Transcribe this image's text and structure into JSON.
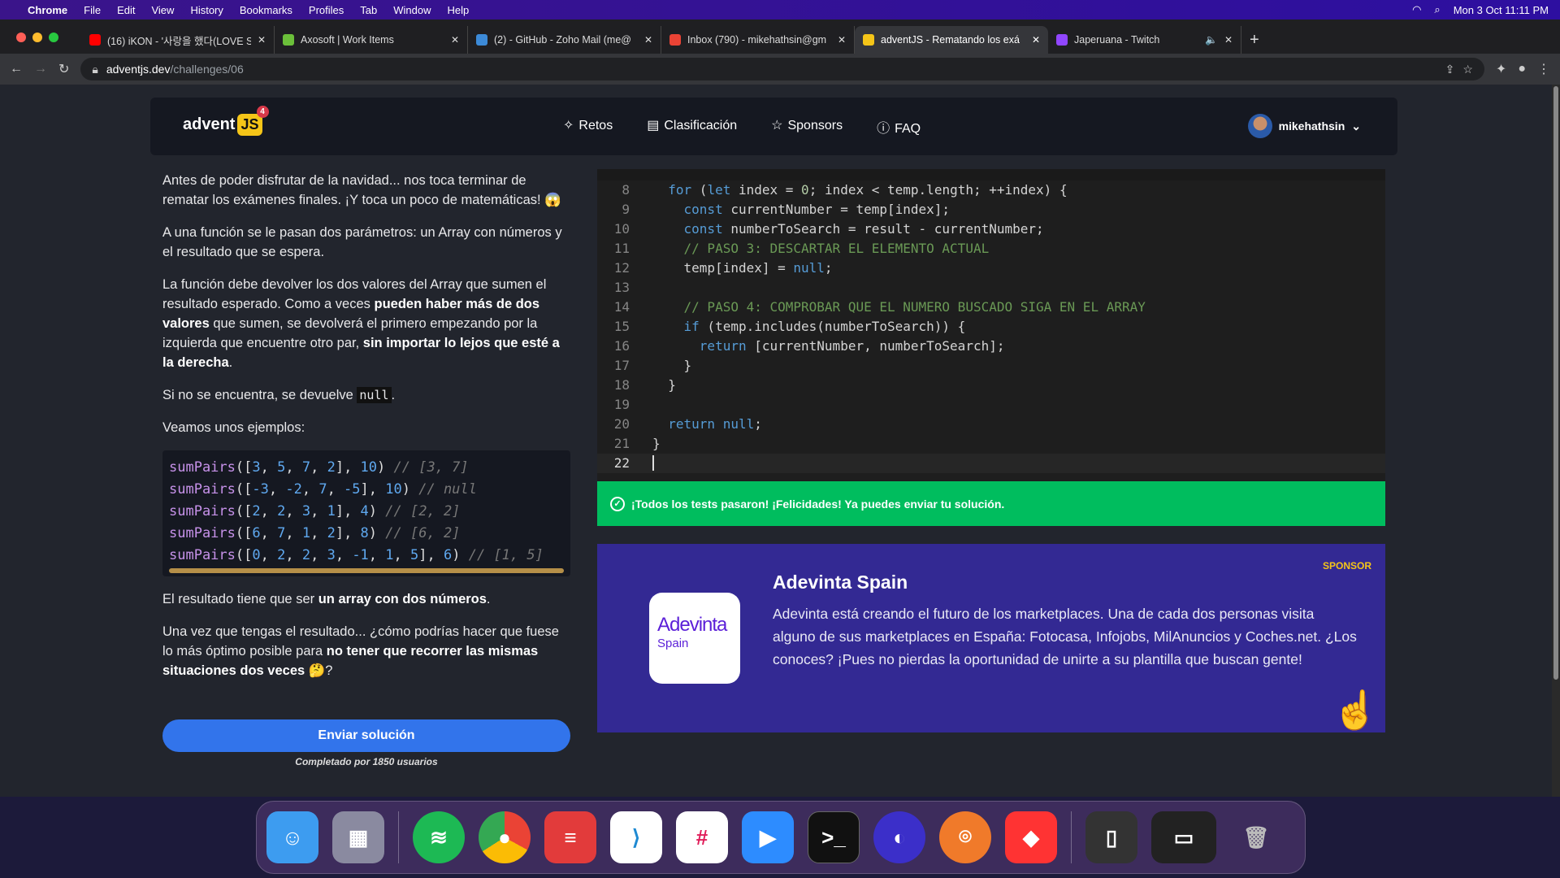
{
  "menubar": {
    "app": "Chrome",
    "items": [
      "File",
      "Edit",
      "View",
      "History",
      "Bookmarks",
      "Profiles",
      "Tab",
      "Window",
      "Help"
    ],
    "clock": "Mon 3 Oct  11:11 PM"
  },
  "tabs": [
    {
      "title": "(16) iKON - '사랑을 했다(LOVE S",
      "color": "#ff0000"
    },
    {
      "title": "Axosoft | Work Items",
      "color": "#6bbf3a"
    },
    {
      "title": "(2) - GitHub - Zoho Mail (me@",
      "color": "#3c8ad8"
    },
    {
      "title": "Inbox (790) - mikehathsin@gm",
      "color": "#ea4335"
    },
    {
      "title": "adventJS - Rematando los exá",
      "color": "#f5c518"
    },
    {
      "title": "Japeruana - Twitch",
      "color": "#9146ff"
    }
  ],
  "address": {
    "host": "adventjs.dev",
    "path": "/challenges/06"
  },
  "header": {
    "logo_text": "advent",
    "logo_js": "JS",
    "logo_badge": "4",
    "nav": [
      "Retos",
      "Clasificación",
      "Sponsors",
      "FAQ"
    ],
    "user": "mikehathsin"
  },
  "description": {
    "p1": "Antes de poder disfrutar de la navidad... nos toca terminar de rematar los exámenes finales. ¡Y toca un poco de matemáticas! 😱",
    "p2": "A una función se le pasan dos parámetros: un Array con números y el resultado que se espera.",
    "p3a": "La función debe devolver los dos valores del Array que sumen el resultado esperado. Como a veces ",
    "p3b": "pueden haber más de dos valores",
    "p3c": " que sumen, se devolverá el primero empezando por la izquierda que encuentre otro par, ",
    "p3d": "sin importar lo lejos que esté a la derecha",
    "p3e": ".",
    "p4a": "Si no se encuentra, se devuelve ",
    "p4code": "null",
    "p4b": ".",
    "p5": "Veamos unos ejemplos:",
    "examples": [
      {
        "fn": "sumPairs",
        "args": "[3, 5, 7, 2], 10",
        "comment": "// [3, 7]"
      },
      {
        "fn": "sumPairs",
        "args": "[-3, -2, 7, -5], 10",
        "comment": "// null"
      },
      {
        "fn": "sumPairs",
        "args": "[2, 2, 3, 1], 4",
        "comment": "// [2, 2]"
      },
      {
        "fn": "sumPairs",
        "args": "[6, 7, 1, 2], 8",
        "comment": "// [6, 2]"
      },
      {
        "fn": "sumPairs",
        "args": "[0, 2, 2, 3, -1, 1, 5], 6",
        "comment": "// [1, 5]"
      }
    ],
    "p6a": "El resultado tiene que ser ",
    "p6b": "un array con dos números",
    "p6c": ".",
    "p7a": "Una vez que tengas el resultado... ¿cómo podrías hacer que fuese lo más óptimo posible para ",
    "p7b": "no tener que recorrer las mismas situaciones dos veces",
    "p7c": " 🤔?"
  },
  "send_button": "Enviar solución",
  "completed": "Completado por 1850 usuarios",
  "editor": {
    "lines": [
      {
        "n": "8",
        "html": "  <span class='kw'>for</span> (<span class='kw'>let</span> index = <span class='nm'>0</span>; index &lt; temp.length; ++index) {"
      },
      {
        "n": "9",
        "html": "    <span class='kw'>const</span> currentNumber = temp[index];"
      },
      {
        "n": "10",
        "html": "    <span class='kw'>const</span> numberToSearch = result - currentNumber;"
      },
      {
        "n": "11",
        "html": "    <span class='cmt'>// PASO 3: DESCARTAR EL ELEMENTO ACTUAL</span>"
      },
      {
        "n": "12",
        "html": "    temp[index] = <span class='kw'>null</span>;"
      },
      {
        "n": "13",
        "html": ""
      },
      {
        "n": "14",
        "html": "    <span class='cmt'>// PASO 4: COMPROBAR QUE EL NUMERO BUSCADO SIGA EN EL ARRAY</span>"
      },
      {
        "n": "15",
        "html": "    <span class='kw'>if</span> (temp.includes(numberToSearch)) {"
      },
      {
        "n": "16",
        "html": "      <span class='kw'>return</span> [currentNumber, numberToSearch];"
      },
      {
        "n": "17",
        "html": "    }"
      },
      {
        "n": "18",
        "html": "  }"
      },
      {
        "n": "19",
        "html": ""
      },
      {
        "n": "20",
        "html": "  <span class='kw'>return</span> <span class='kw'>null</span>;"
      },
      {
        "n": "21",
        "html": "}"
      },
      {
        "n": "22",
        "html": ""
      }
    ]
  },
  "test_result": "¡Todos los tests pasaron! ¡Felicidades! Ya puedes enviar tu solución.",
  "sponsor": {
    "tag": "SPONSOR",
    "logo_a": "Adevinta",
    "logo_s": "Spain",
    "title": "Adevinta Spain",
    "description": "Adevinta está creando el futuro de los marketplaces. Una de cada dos personas visita alguno de sus marketplaces en España: Fotocasa, Infojobs, MilAnuncios y Coches.net. ¿Los conoces? ¡Pues no pierdas la oportunidad de unirte a su plantilla que buscan gente!"
  }
}
